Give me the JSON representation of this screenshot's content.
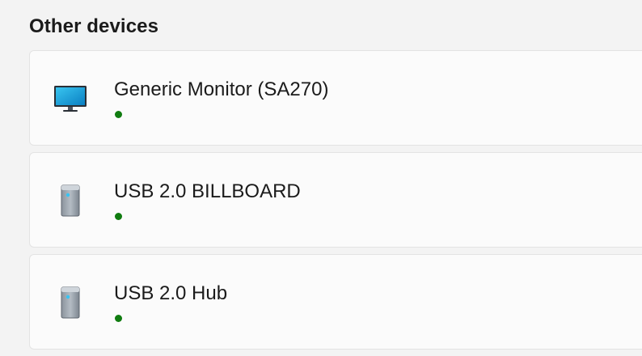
{
  "section": {
    "title": "Other devices"
  },
  "devices": [
    {
      "name": "Generic Monitor (SA270)",
      "icon": "monitor-icon",
      "status_color": "#107c10"
    },
    {
      "name": "USB 2.0 BILLBOARD",
      "icon": "usb-device-icon",
      "status_color": "#107c10"
    },
    {
      "name": "USB 2.0 Hub",
      "icon": "usb-device-icon",
      "status_color": "#107c10"
    }
  ]
}
